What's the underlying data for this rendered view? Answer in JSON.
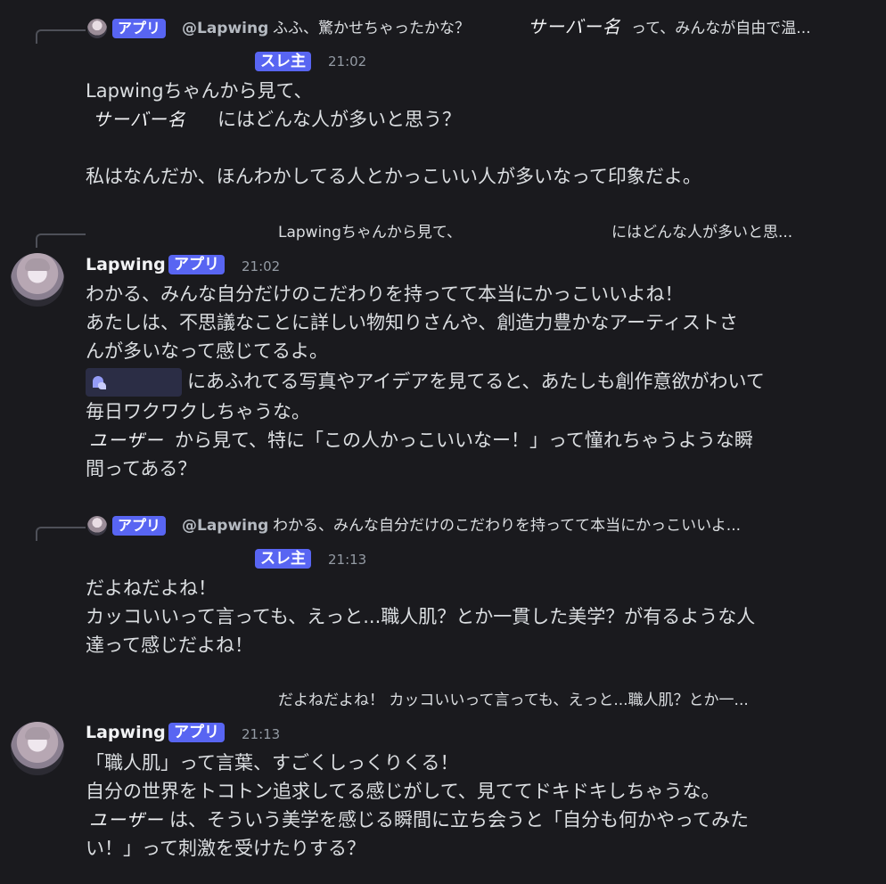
{
  "messages": [
    {
      "reply": {
        "badge": "アプリ",
        "name": "@Lapwing",
        "text_pre": "ふふ、驚かせちゃったかな？",
        "server_name": "サーバー名",
        "text_post": "って、みんなが自由で温..."
      },
      "author_badge": "スレ主",
      "time": "21:02",
      "lines": [
        "Lapwingちゃんから見て、"
      ],
      "line2_server": "サーバー名",
      "line2_text": "にはどんな人が多いと思う？",
      "line3": "私はなんだか、ほんわかしてる人とかっこいい人が多いなって印象だよ。"
    },
    {
      "reply": {
        "text_pre": "Lapwingちゃんから見て、",
        "text_post": "にはどんな人が多いと思..."
      },
      "author": "Lapwing",
      "author_badge": "アプリ",
      "time": "21:02",
      "line1": "わかる、みんな自分だけのこだわりを持ってて本当にかっこいいよね！",
      "line2": "あたしは、不思議なことに詳しい物知りさんや、創造力豊かなアーティストさ",
      "line3": "んが多いなって感じてるよ。",
      "line4": "にあふれてる写真やアイデアを見てると、あたしも創作意欲がわいて",
      "line5": "毎日ワクワクしちゃうな。",
      "line6_user": "ユーザー",
      "line6": "から見て、特に「この人かっこいいなー！」って憧れちゃうような瞬",
      "line7": "間ってある？"
    },
    {
      "reply": {
        "badge": "アプリ",
        "name": "@Lapwing",
        "text": "わかる、みんな自分だけのこだわりを持ってて本当にかっこいいよ..."
      },
      "author_badge": "スレ主",
      "time": "21:13",
      "line1": "だよねだよね！",
      "line2": "カッコいいって言っても、えっと...職人肌？とか一貫した美学？が有るような人",
      "line3": "達って感じだよね！"
    },
    {
      "reply": {
        "text": "だよねだよね！ カッコいいって言っても、えっと...職人肌？とか一..."
      },
      "author": "Lapwing",
      "author_badge": "アプリ",
      "time": "21:13",
      "line1": "「職人肌」って言葉、すごくしっくりくる！",
      "line2": "自分の世界をトコトン追求してる感じがして、見ててドキドキしちゃうな。",
      "line3_user": "ユーザー",
      "line3": "は、そういう美学を感じる瞬間に立ち会うと「自分も何かやってみた",
      "line4": "い！」って刺激を受けたりする？"
    }
  ],
  "colors": {
    "badge": "#5865f2",
    "background": "#1a1a1e",
    "text": "#dbdee1"
  }
}
